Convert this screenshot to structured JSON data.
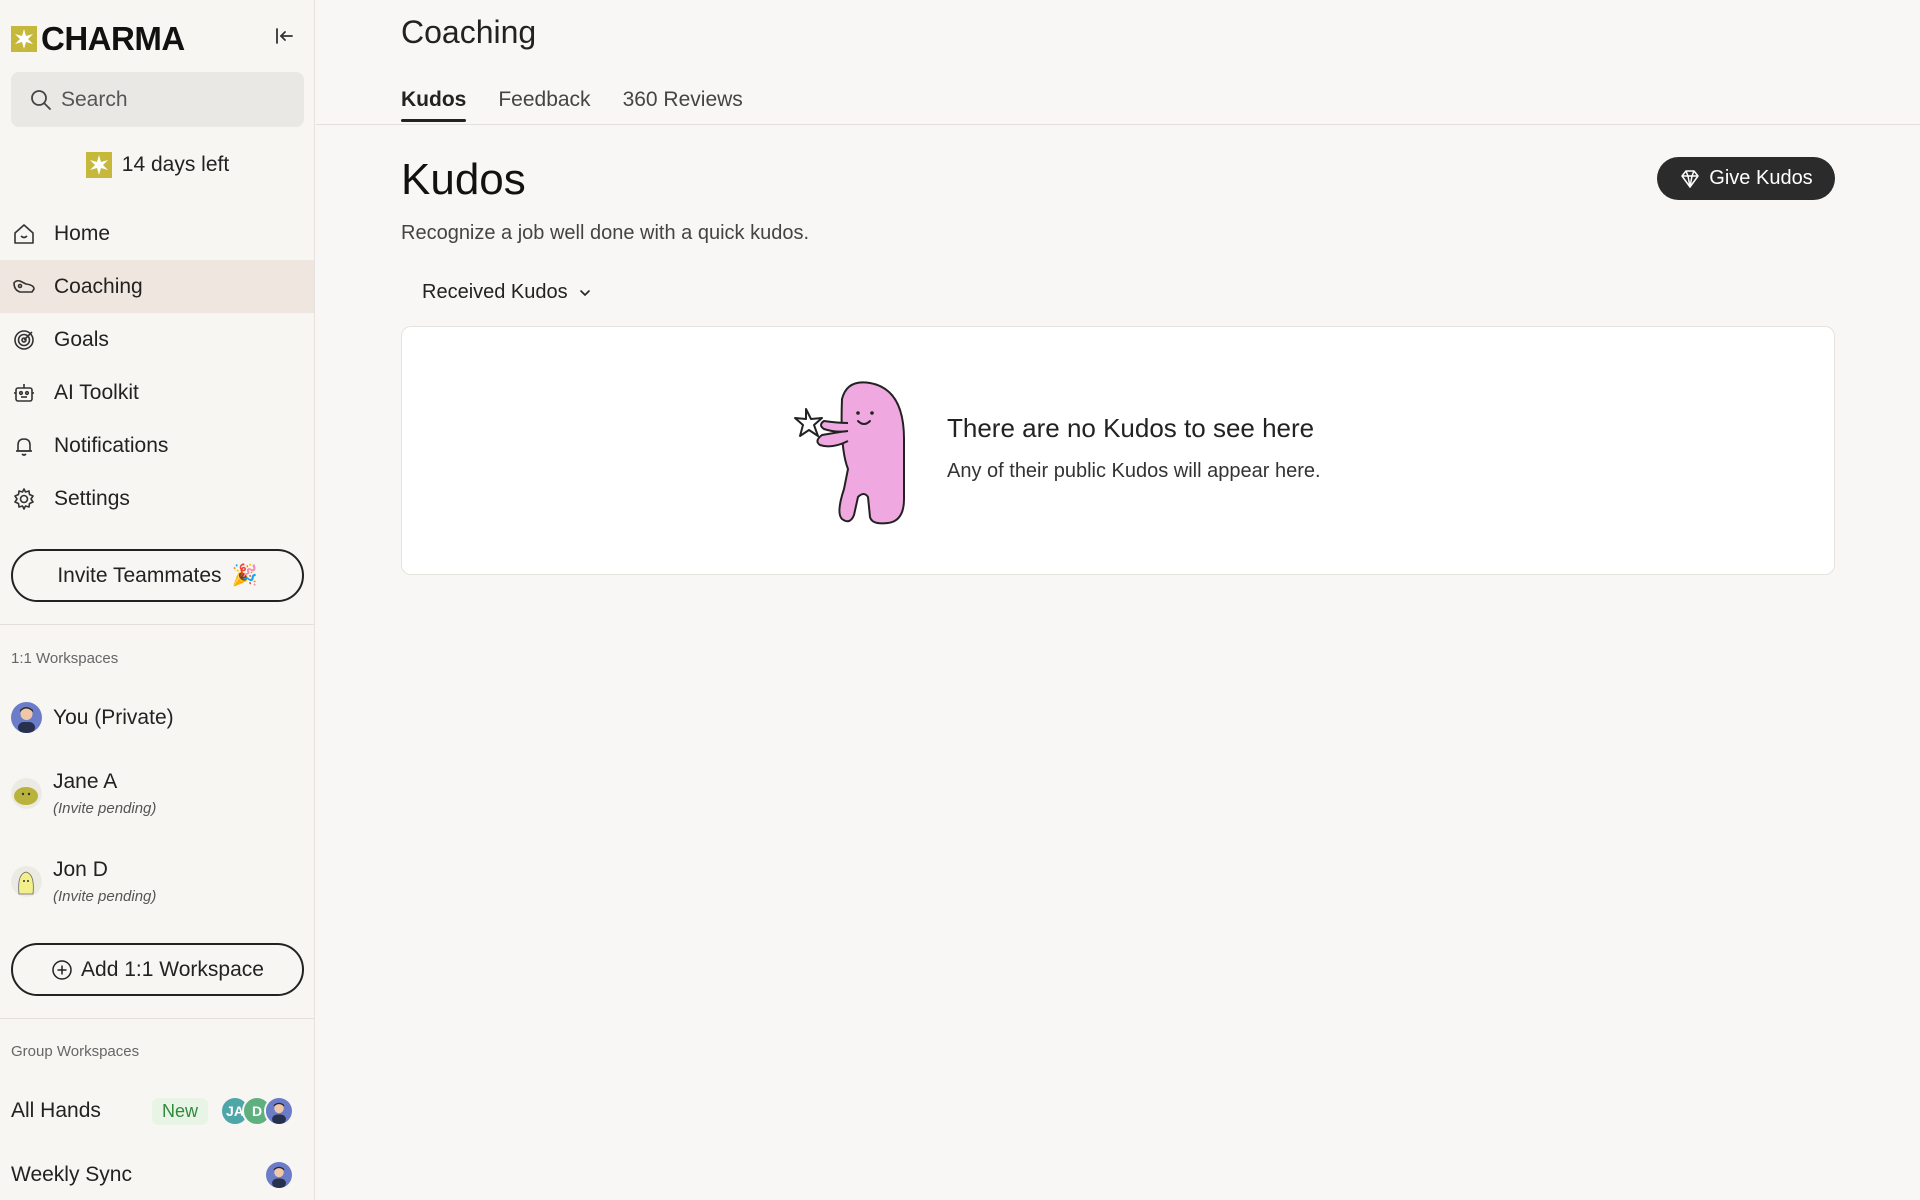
{
  "app": {
    "brand": "CHARMA",
    "brand_color": "#c5b83a"
  },
  "sidebar": {
    "search_placeholder": "Search",
    "trial_text": "14 days left",
    "nav": [
      {
        "label": "Home",
        "icon": "home-icon"
      },
      {
        "label": "Coaching",
        "icon": "coaching-icon",
        "active": true
      },
      {
        "label": "Goals",
        "icon": "target-icon"
      },
      {
        "label": "AI Toolkit",
        "icon": "robot-icon"
      },
      {
        "label": "Notifications",
        "icon": "bell-icon"
      },
      {
        "label": "Settings",
        "icon": "gear-icon"
      }
    ],
    "invite_label": "Invite Teammates",
    "one_on_one_label": "1:1 Workspaces",
    "workspaces": [
      {
        "name": "You (Private)",
        "sub": ""
      },
      {
        "name": "Jane A",
        "sub": "(Invite pending)"
      },
      {
        "name": "Jon D",
        "sub": "(Invite pending)"
      }
    ],
    "add_workspace_label": "Add 1:1 Workspace",
    "group_label": "Group Workspaces",
    "groups": [
      {
        "name": "All Hands",
        "badge": "New",
        "avatars": [
          "JA",
          "D"
        ]
      },
      {
        "name": "Weekly Sync"
      }
    ]
  },
  "main": {
    "page_title": "Coaching",
    "tabs": [
      {
        "label": "Kudos",
        "active": true
      },
      {
        "label": "Feedback"
      },
      {
        "label": "360 Reviews"
      }
    ],
    "section_title": "Kudos",
    "section_subtitle": "Recognize a job well done with a quick kudos.",
    "give_button": "Give Kudos",
    "filter_label": "Received Kudos",
    "empty": {
      "title": "There are no Kudos to see here",
      "subtitle": "Any of their public Kudos will appear here."
    }
  }
}
